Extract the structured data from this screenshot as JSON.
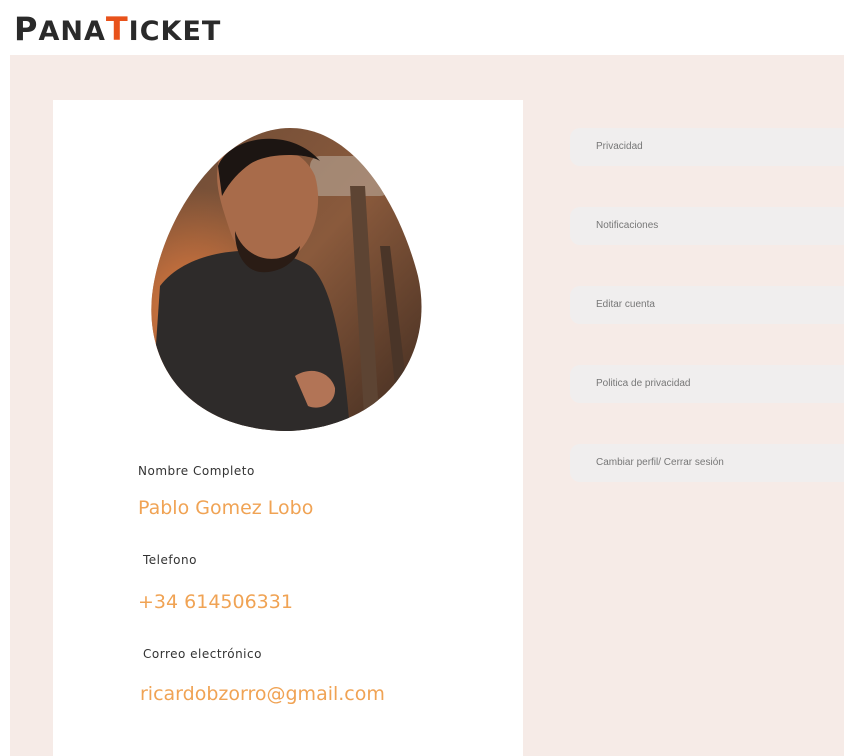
{
  "brand": {
    "p": "P",
    "ana": "ANA",
    "t": "T",
    "icket": "ICKET"
  },
  "profile": {
    "name_label": "Nombre Completo",
    "name_value": "Pablo Gomez Lobo",
    "phone_label": "Telefono",
    "phone_value": "+34 614506331",
    "email_label": "Correo electrónico",
    "email_value": "ricardobzorro@gmail.com"
  },
  "menu": {
    "items": [
      {
        "label": "Privacidad"
      },
      {
        "label": "Notificaciones"
      },
      {
        "label": "Editar cuenta"
      },
      {
        "label": "Politica de privacidad"
      },
      {
        "label": "Cambiar perfil/ Cerrar sesión"
      }
    ]
  },
  "colors": {
    "accent": "#e8521b",
    "value_text": "#f0a354",
    "background": "#f6ebe7",
    "menu_bg": "#f0eeee"
  }
}
